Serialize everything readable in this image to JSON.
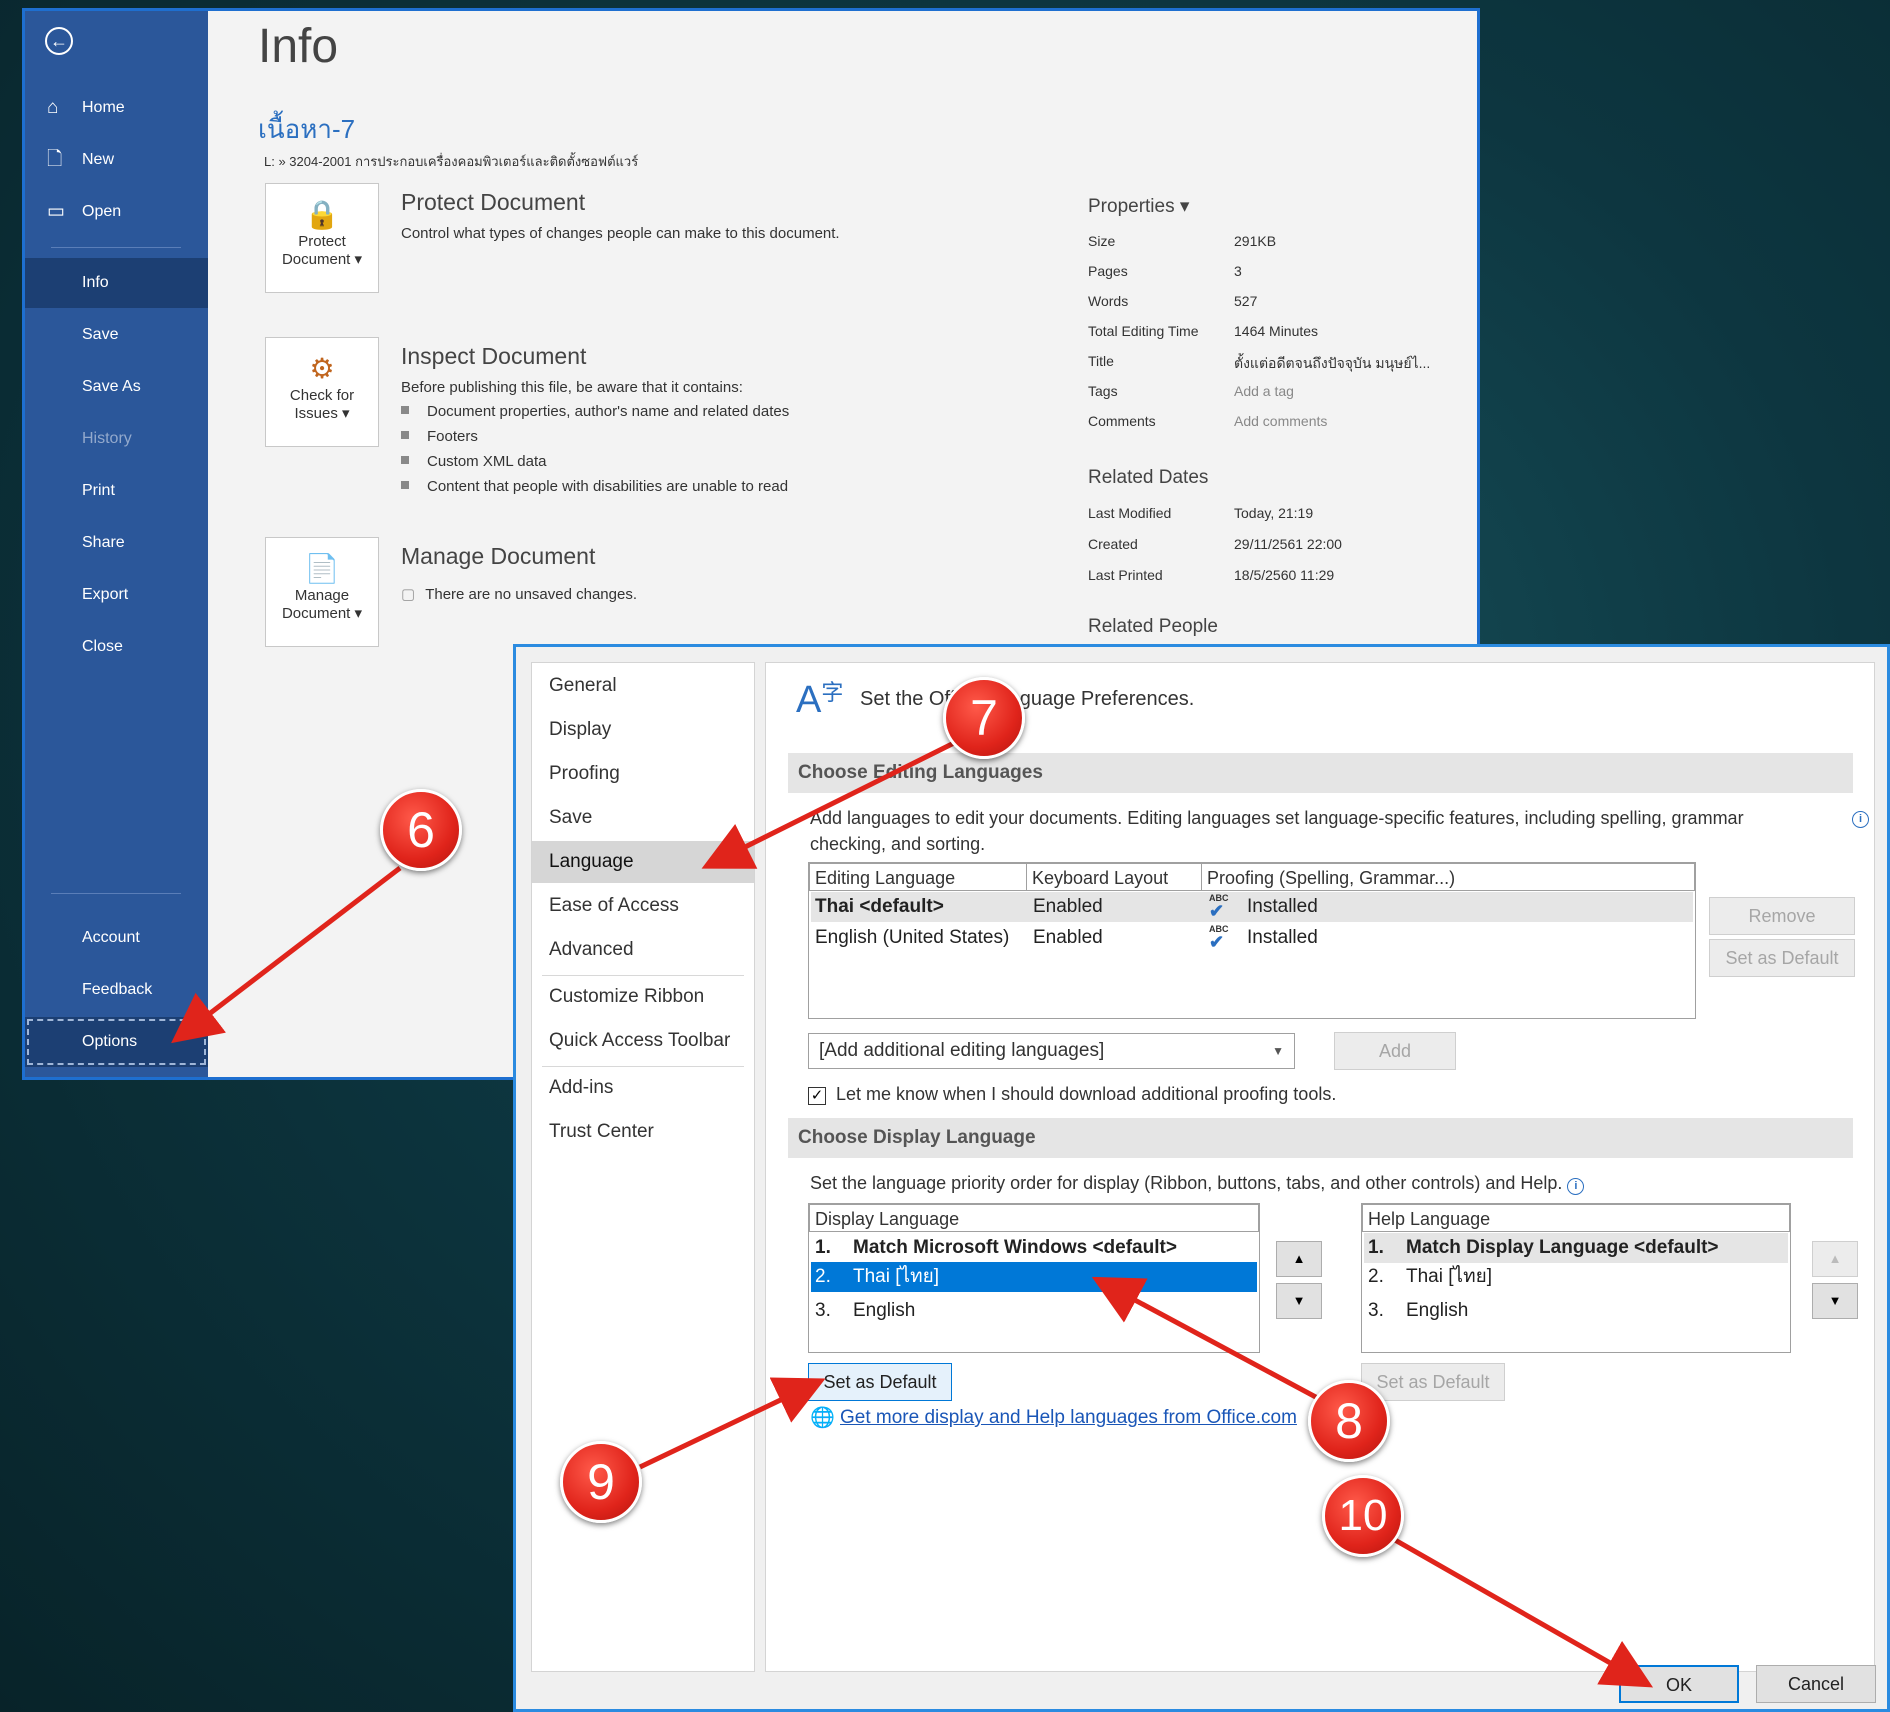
{
  "backstage": {
    "sidebar": {
      "back_icon": "back-arrow-icon",
      "items": [
        {
          "label": "Home",
          "icon": "home-icon"
        },
        {
          "label": "New",
          "icon": "new-document-icon"
        },
        {
          "label": "Open",
          "icon": "folder-open-icon"
        },
        {
          "label": "Info"
        },
        {
          "label": "Save"
        },
        {
          "label": "Save As"
        },
        {
          "label": "History"
        },
        {
          "label": "Print"
        },
        {
          "label": "Share"
        },
        {
          "label": "Export"
        },
        {
          "label": "Close"
        },
        {
          "label": "Account"
        },
        {
          "label": "Feedback"
        },
        {
          "label": "Options"
        }
      ]
    },
    "title": "Info",
    "doc_name": "เนื้อหา-7",
    "doc_path": "L: » 3204-2001 การประกอบเครื่องคอมพิวเตอร์และติดตั้งซอฟต์แวร์",
    "protect": {
      "tile_line1": "Protect",
      "tile_line2": "Document ▾",
      "heading": "Protect Document",
      "text": "Control what types of changes people can make to this document."
    },
    "inspect": {
      "tile_line1": "Check for",
      "tile_line2": "Issues ▾",
      "heading": "Inspect Document",
      "text": "Before publishing this file, be aware that it contains:",
      "bullets": [
        "Document properties, author's name and related dates",
        "Footers",
        "Custom XML data",
        "Content that people with disabilities are unable to read"
      ]
    },
    "manage": {
      "tile_line1": "Manage",
      "tile_line2": "Document ▾",
      "heading": "Manage Document",
      "text": "There are no unsaved changes."
    },
    "properties": {
      "heading": "Properties ▾",
      "rows": [
        {
          "k": "Size",
          "v": "291KB"
        },
        {
          "k": "Pages",
          "v": "3"
        },
        {
          "k": "Words",
          "v": "527"
        },
        {
          "k": "Total Editing Time",
          "v": "1464 Minutes"
        },
        {
          "k": "Title",
          "v": "ตั้งแต่อดีตจนถึงปัจจุบัน มนุษย์ไ..."
        },
        {
          "k": "Tags",
          "v": "Add a tag"
        },
        {
          "k": "Comments",
          "v": "Add comments"
        }
      ]
    },
    "related_dates": {
      "heading": "Related Dates",
      "rows": [
        {
          "k": "Last Modified",
          "v": "Today, 21:19"
        },
        {
          "k": "Created",
          "v": "29/11/2561 22:00"
        },
        {
          "k": "Last Printed",
          "v": "18/5/2560 11:29"
        }
      ]
    },
    "related_people": {
      "heading": "Related People"
    }
  },
  "dialog": {
    "nav": [
      "General",
      "Display",
      "Proofing",
      "Save",
      "Language",
      "Ease of Access",
      "Advanced",
      "Customize Ribbon",
      "Quick Access Toolbar",
      "Add-ins",
      "Trust Center"
    ],
    "selected_nav": "Language",
    "title": "Set the Office Language Preferences.",
    "editing": {
      "heading": "Choose Editing Languages",
      "desc_line1": "Add languages to edit your documents. Editing languages set language-specific features, including spelling, grammar",
      "desc_line2": "checking, and sorting.",
      "columns": [
        "Editing Language",
        "Keyboard Layout",
        "Proofing (Spelling, Grammar...)"
      ],
      "rows": [
        {
          "lang": "Thai <default>",
          "kb": "Enabled",
          "proof": "Installed"
        },
        {
          "lang": "English (United States)",
          "kb": "Enabled",
          "proof": "Installed"
        }
      ],
      "remove_btn": "Remove",
      "set_default_btn": "Set as Default",
      "add_combo": "[Add additional editing languages]",
      "add_btn": "Add",
      "checkbox_label": "Let me know when I should download additional proofing tools.",
      "checkbox_checked": true
    },
    "display": {
      "heading": "Choose Display Language",
      "desc": "Set the language priority order for display (Ribbon, buttons, tabs, and other controls) and Help.",
      "display_col": "Display Language",
      "display_rows": [
        {
          "num": "1.",
          "name": "Match Microsoft Windows <default>"
        },
        {
          "num": "2.",
          "name": "Thai [ไทย]"
        },
        {
          "num": "3.",
          "name": "English"
        }
      ],
      "help_col": "Help Language",
      "help_rows": [
        {
          "num": "1.",
          "name": "Match Display Language <default>"
        },
        {
          "num": "2.",
          "name": "Thai [ไทย]"
        },
        {
          "num": "3.",
          "name": "English"
        }
      ],
      "set_default_btn": "Set as Default",
      "help_set_default_btn": "Set as Default",
      "link": "Get more display and Help languages from Office.com"
    },
    "ok": "OK",
    "cancel": "Cancel"
  },
  "callouts": [
    "6",
    "7",
    "8",
    "9",
    "10"
  ],
  "colors": {
    "accent": "#2b579a",
    "callout": "#e0241b",
    "selection": "#0078d7"
  }
}
